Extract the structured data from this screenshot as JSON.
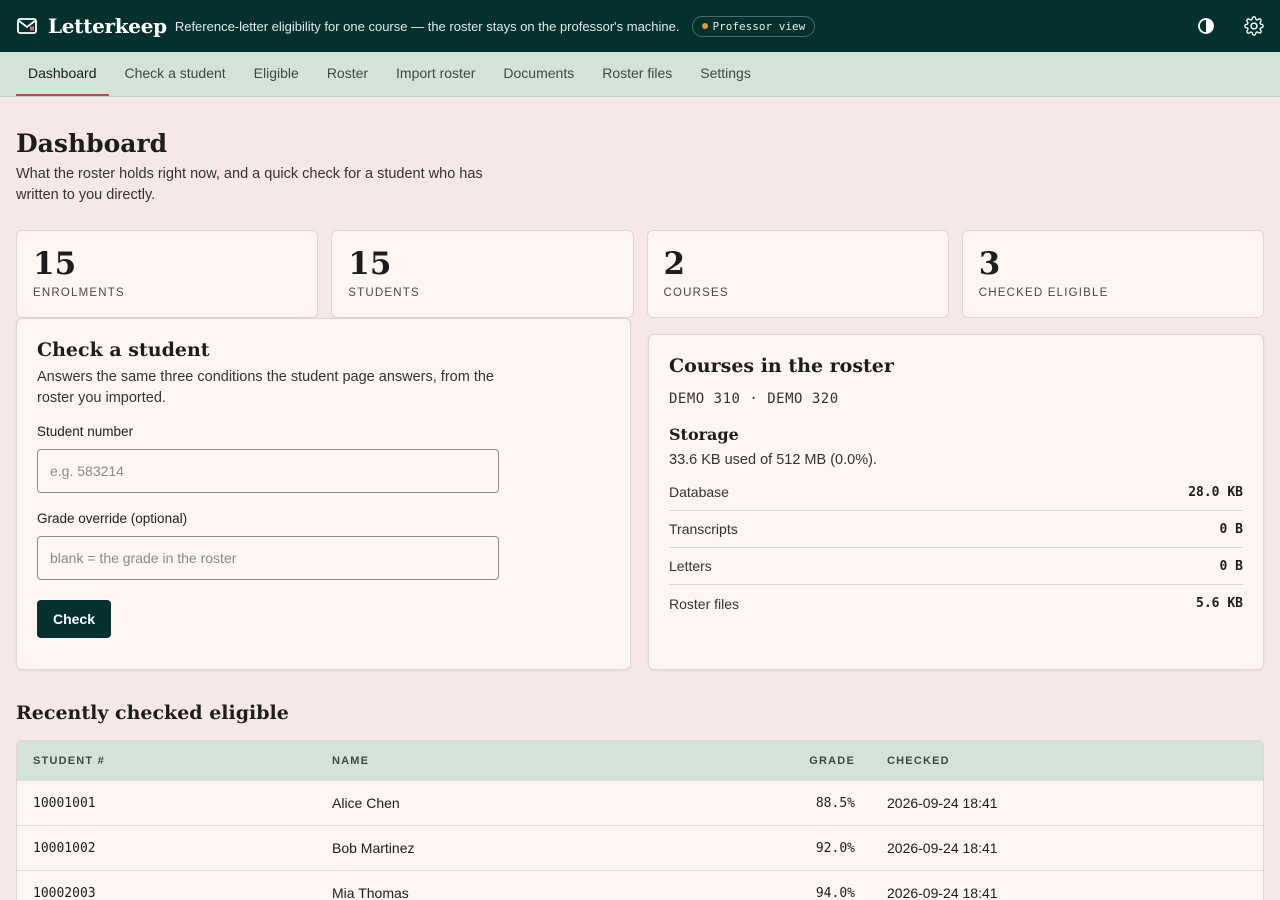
{
  "header": {
    "brand": "Letterkeep",
    "tagline": "Reference-letter eligibility for one course — the roster stays on the professor's machine.",
    "role": "Professor view"
  },
  "nav": {
    "tabs": [
      {
        "label": "Dashboard",
        "active": true
      },
      {
        "label": "Check a student"
      },
      {
        "label": "Eligible"
      },
      {
        "label": "Roster"
      },
      {
        "label": "Import roster"
      },
      {
        "label": "Documents"
      },
      {
        "label": "Roster files"
      },
      {
        "label": "Settings"
      }
    ]
  },
  "page": {
    "title": "Dashboard",
    "subtitle": "What the roster holds right now, and a quick check for a student who has written to you directly."
  },
  "stats": [
    {
      "value": "15",
      "label": "ENROLMENTS"
    },
    {
      "value": "15",
      "label": "STUDENTS"
    },
    {
      "value": "2",
      "label": "COURSES"
    },
    {
      "value": "3",
      "label": "CHECKED ELIGIBLE"
    }
  ],
  "check": {
    "title": "Check a student",
    "subtitle": "Answers the same three conditions the student page answers, from the roster you imported.",
    "student_label": "Student number",
    "student_placeholder": "e.g. 583214",
    "grade_label": "Grade override (optional)",
    "grade_placeholder": "blank = the grade in the roster",
    "button": "Check"
  },
  "courses": {
    "title": "Courses in the roster",
    "codes": "DEMO 310 · DEMO 320",
    "storage_title": "Storage",
    "storage_summary": "33.6 KB used of 512 MB (0.0%).",
    "storage_rows": [
      {
        "label": "Database",
        "value": "28.0 KB"
      },
      {
        "label": "Transcripts",
        "value": "0 B"
      },
      {
        "label": "Letters",
        "value": "0 B"
      },
      {
        "label": "Roster files",
        "value": "5.6 KB"
      }
    ]
  },
  "recent": {
    "title": "Recently checked eligible",
    "columns": [
      "STUDENT #",
      "NAME",
      "GRADE",
      "CHECKED"
    ],
    "rows": [
      {
        "id": "10001001",
        "name": "Alice Chen",
        "grade": "88.5%",
        "checked": "2026-09-24 18:41"
      },
      {
        "id": "10001002",
        "name": "Bob Martinez",
        "grade": "92.0%",
        "checked": "2026-09-24 18:41"
      },
      {
        "id": "10002003",
        "name": "Mia Thomas",
        "grade": "94.0%",
        "checked": "2026-09-24 18:41"
      }
    ]
  },
  "colors": {
    "topbar": "#04302e",
    "nav": "#d4e3d9",
    "page_bg": "#f5e8e7",
    "accent": "#c0485a"
  },
  "icons": {
    "brand": "envelope-icon",
    "theme": "contrast-icon",
    "settings": "gear-icon"
  }
}
